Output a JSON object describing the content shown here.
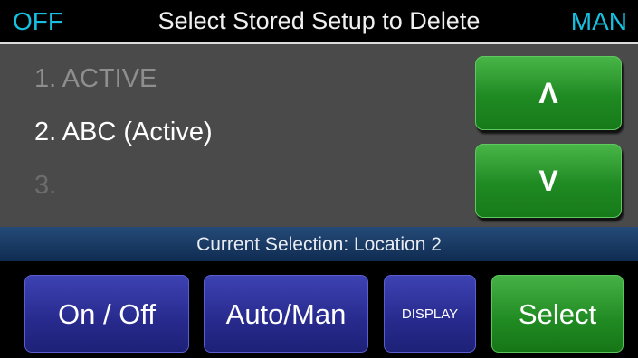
{
  "header": {
    "output_state": "OFF",
    "title": "Select Stored Setup to Delete",
    "mode": "MAN"
  },
  "setups": [
    {
      "label": "1. ACTIVE"
    },
    {
      "label": "2. ABC (Active)"
    },
    {
      "label": "3."
    }
  ],
  "nav": {
    "up_label": "Λ",
    "down_label": "V"
  },
  "status": {
    "text": "Current Selection: Location 2"
  },
  "buttons": {
    "on_off": "On / Off",
    "auto_man": "Auto/Man",
    "display": "DISPLAY",
    "select": "Select"
  }
}
